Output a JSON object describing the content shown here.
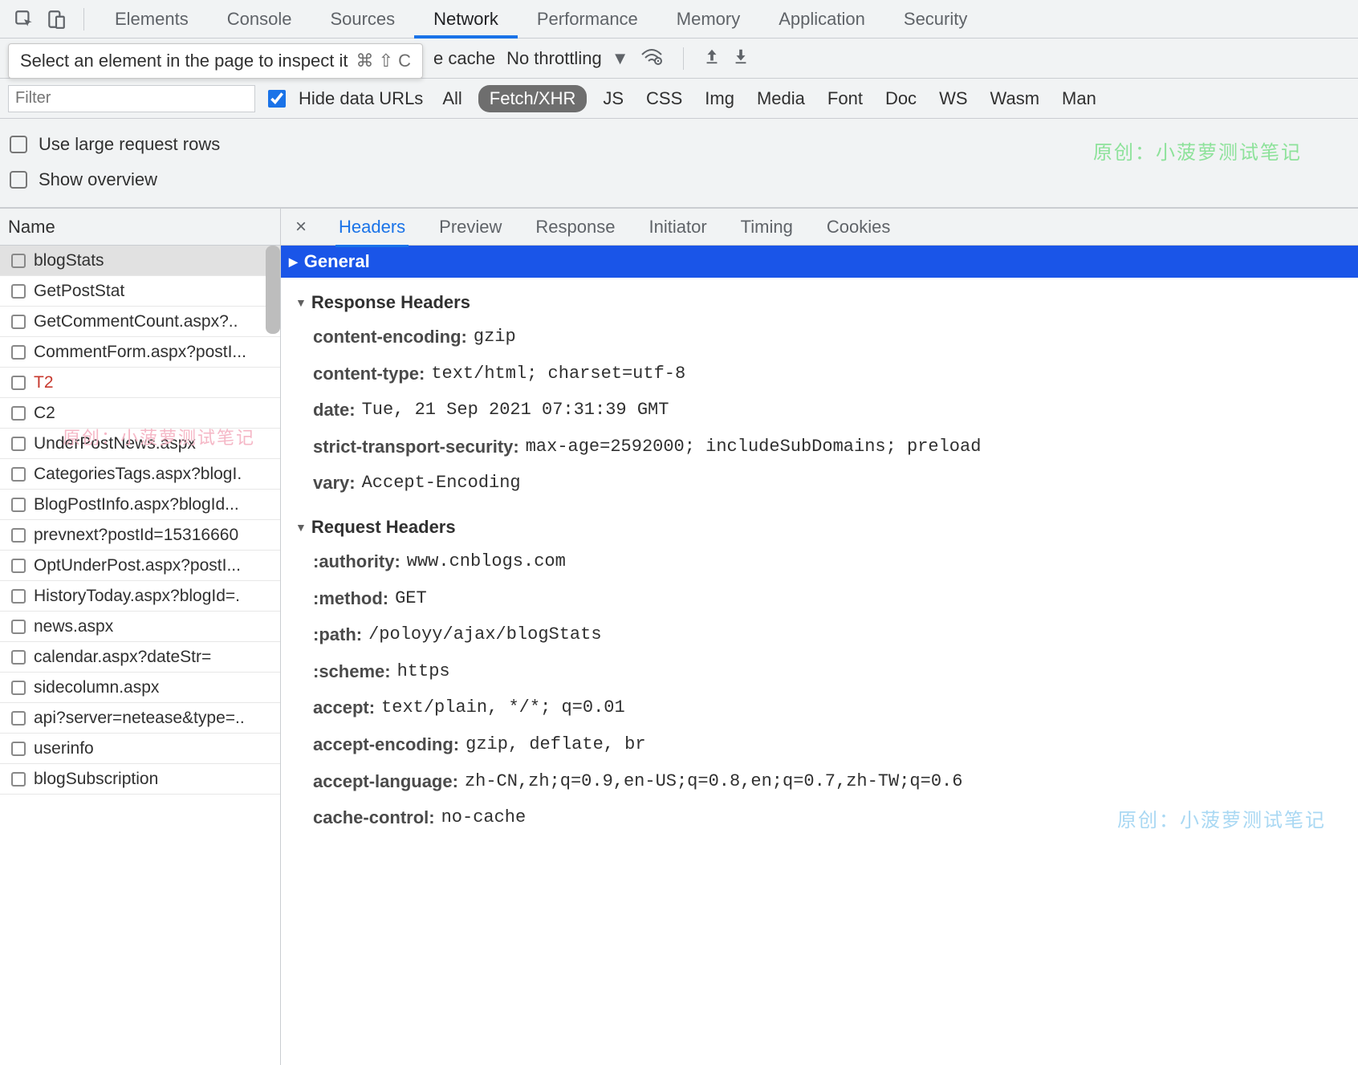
{
  "tooltip": {
    "text": "Select an element in the page to inspect it",
    "shortcut": "⌘ ⇧ C"
  },
  "top_tabs": [
    "Elements",
    "Console",
    "Sources",
    "Network",
    "Performance",
    "Memory",
    "Application",
    "Security"
  ],
  "top_tabs_active": "Network",
  "toolbar": {
    "cache_fragment": "e cache",
    "throttling_label": "No throttling"
  },
  "filter": {
    "placeholder": "Filter",
    "hide_data_urls_label": "Hide data URLs",
    "hide_data_urls_checked": true,
    "types": [
      "All",
      "Fetch/XHR",
      "JS",
      "CSS",
      "Img",
      "Media",
      "Font",
      "Doc",
      "WS",
      "Wasm",
      "Man"
    ],
    "type_active": "Fetch/XHR"
  },
  "options": {
    "use_large_rows": "Use large request rows",
    "show_overview": "Show overview"
  },
  "left": {
    "header": "Name",
    "rows": [
      {
        "name": "blogStats",
        "selected": true
      },
      {
        "name": "GetPostStat"
      },
      {
        "name": "GetCommentCount.aspx?.."
      },
      {
        "name": "CommentForm.aspx?postI..."
      },
      {
        "name": "T2",
        "error": true
      },
      {
        "name": "C2"
      },
      {
        "name": "UnderPostNews.aspx"
      },
      {
        "name": "CategoriesTags.aspx?blogI."
      },
      {
        "name": "BlogPostInfo.aspx?blogId..."
      },
      {
        "name": "prevnext?postId=15316660"
      },
      {
        "name": "OptUnderPost.aspx?postI..."
      },
      {
        "name": "HistoryToday.aspx?blogId=."
      },
      {
        "name": "news.aspx"
      },
      {
        "name": "calendar.aspx?dateStr="
      },
      {
        "name": "sidecolumn.aspx"
      },
      {
        "name": "api?server=netease&type=.."
      },
      {
        "name": "userinfo"
      },
      {
        "name": "blogSubscription"
      }
    ]
  },
  "detail_tabs": [
    "Headers",
    "Preview",
    "Response",
    "Initiator",
    "Timing",
    "Cookies"
  ],
  "detail_tabs_active": "Headers",
  "general_label": "General",
  "response_headers_title": "Response Headers",
  "request_headers_title": "Request Headers",
  "response_headers": [
    {
      "k": "content-encoding:",
      "v": "gzip"
    },
    {
      "k": "content-type:",
      "v": "text/html; charset=utf-8"
    },
    {
      "k": "date:",
      "v": "Tue, 21 Sep 2021 07:31:39 GMT"
    },
    {
      "k": "strict-transport-security:",
      "v": "max-age=2592000; includeSubDomains; preload"
    },
    {
      "k": "vary:",
      "v": "Accept-Encoding"
    }
  ],
  "request_headers": [
    {
      "k": ":authority:",
      "v": "www.cnblogs.com"
    },
    {
      "k": ":method:",
      "v": "GET"
    },
    {
      "k": ":path:",
      "v": "/poloyy/ajax/blogStats"
    },
    {
      "k": ":scheme:",
      "v": "https"
    },
    {
      "k": "accept:",
      "v": "text/plain, */*; q=0.01"
    },
    {
      "k": "accept-encoding:",
      "v": "gzip, deflate, br"
    },
    {
      "k": "accept-language:",
      "v": "zh-CN,zh;q=0.9,en-US;q=0.8,en;q=0.7,zh-TW;q=0.6"
    },
    {
      "k": "cache-control:",
      "v": "no-cache"
    }
  ],
  "watermarks": {
    "w1": "原创：小菠萝测试笔记",
    "w2": "原创：小菠萝测试笔记",
    "w3": "原创：小菠萝测试笔记"
  }
}
